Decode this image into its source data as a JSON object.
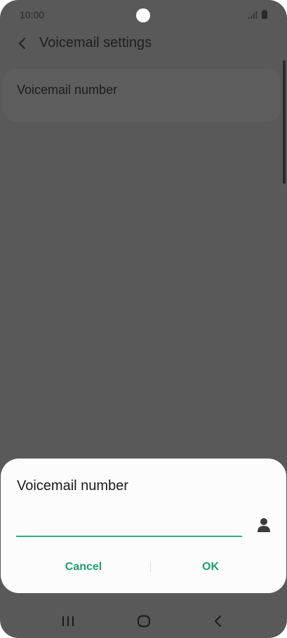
{
  "status_bar": {
    "time": "10:00",
    "icons": [
      "camera-cutout",
      "signal-icon",
      "battery-icon"
    ]
  },
  "header": {
    "title": "Voicemail settings",
    "back_icon": "chevron-left-icon"
  },
  "settings": {
    "items": [
      {
        "label": "Voicemail number"
      }
    ]
  },
  "dialog": {
    "title": "Voicemail number",
    "input_value": "",
    "contact_icon": "person-icon",
    "cancel_label": "Cancel",
    "ok_label": "OK"
  },
  "nav_bar": {
    "icons": [
      "recents-icon",
      "home-icon",
      "back-icon"
    ]
  },
  "colors": {
    "overlay": "#595959",
    "accent": "#1f9d73",
    "input_underline": "#2fae7f",
    "dialog_bg": "#fcfcfc"
  }
}
